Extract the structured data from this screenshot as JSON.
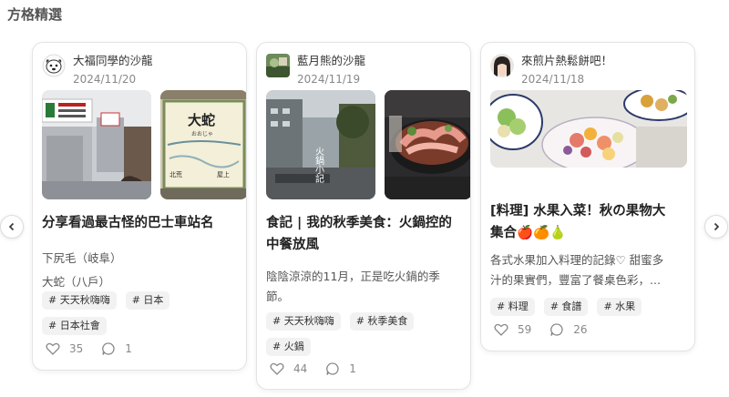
{
  "section": {
    "title": "方格精選"
  },
  "cards": [
    {
      "author": "大福同學的沙龍",
      "date": "2024/11/20",
      "title": "分享看過最古怪的巴士車站名",
      "desc": [
        "下尻毛（岐阜）",
        "大蛇（八戶）"
      ],
      "tags": [
        "# 天天秋嗨嗨",
        "# 日本",
        "# 日本社會"
      ],
      "likes": "35",
      "comments": "1",
      "image_text": {
        "sign": "大蛇",
        "sign_small": "おおじゃ",
        "left": "北荒",
        "right": "屋上"
      }
    },
    {
      "author": "藍月熊的沙龍",
      "date": "2024/11/19",
      "title_lines": [
        "食記 | 我的秋季美食：火鍋控的",
        "中餐放風"
      ],
      "desc": [
        "陰陰涼涼的11月，正是吃火鍋的季",
        "節。"
      ],
      "tags": [
        "# 天天秋嗨嗨",
        "# 秋季美食",
        "# 火鍋"
      ],
      "likes": "44",
      "comments": "1",
      "image_text": {
        "vertical": "火鍋小記"
      }
    },
    {
      "author": "來煎片熱鬆餅吧！",
      "date": "2024/11/18",
      "title_lines": [
        "[料理] 水果入菜！秋の果物大",
        "集合🍎🍊🍐"
      ],
      "desc": [
        "各式水果加入料理的記錄♡ 甜蜜多",
        "汁的果實們，豐富了餐桌色彩，..."
      ],
      "tags": [
        "# 料理",
        "# 食譜",
        "# 水果"
      ],
      "likes": "59",
      "comments": "26"
    }
  ]
}
